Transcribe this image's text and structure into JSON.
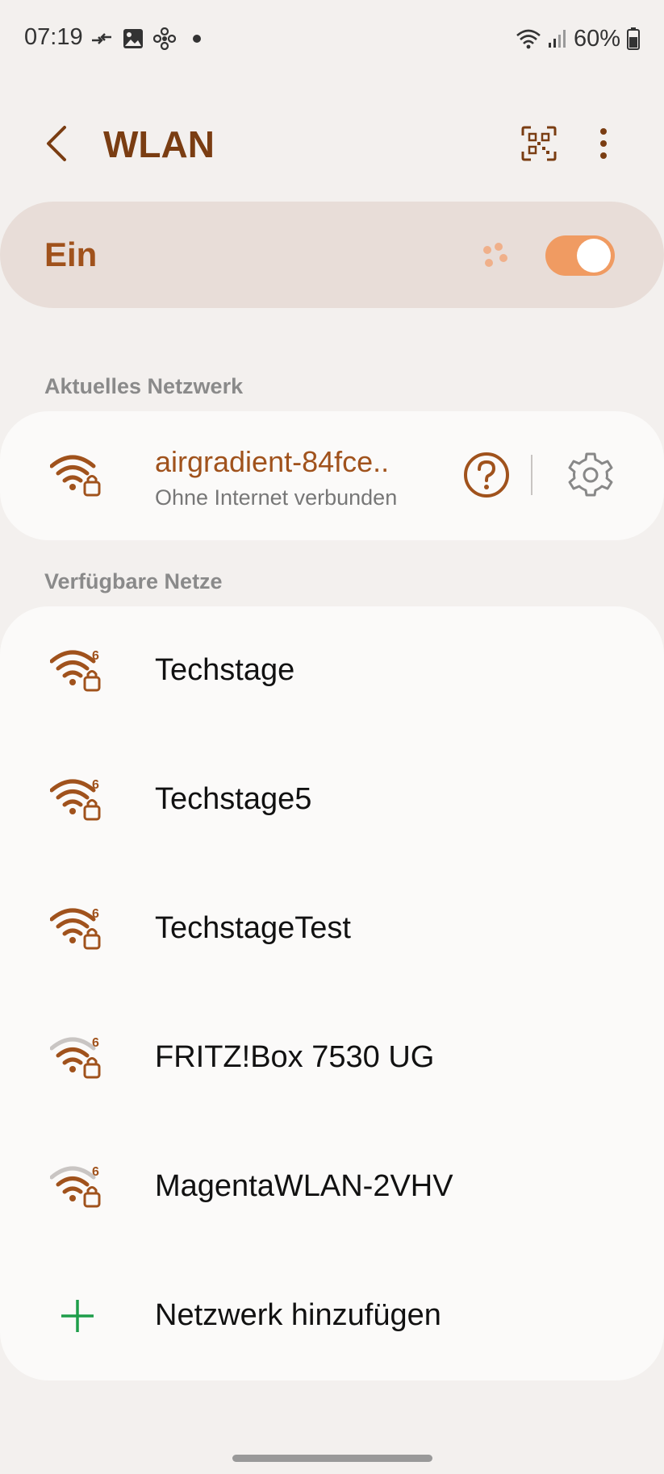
{
  "status_bar": {
    "time": "07:19",
    "battery": "60%"
  },
  "app_bar": {
    "title": "WLAN"
  },
  "toggle": {
    "label": "Ein",
    "state": "on"
  },
  "current_section": {
    "label": "Aktuelles Netzwerk",
    "network": {
      "name": "airgradient-84fce..",
      "status": "Ohne Internet verbunden"
    }
  },
  "available_section": {
    "label": "Verfügbare Netze",
    "networks": [
      {
        "name": "Techstage",
        "signal": "full",
        "band": "6"
      },
      {
        "name": "Techstage5",
        "signal": "full",
        "band": "6"
      },
      {
        "name": "TechstageTest",
        "signal": "full",
        "band": "6"
      },
      {
        "name": "FRITZ!Box 7530 UG",
        "signal": "medium",
        "band": "6"
      },
      {
        "name": "MagentaWLAN-2VHV",
        "signal": "medium",
        "band": "6"
      }
    ],
    "add_network": "Netzwerk hinzufügen"
  },
  "colors": {
    "accent": "#a0521c",
    "title": "#7a3d12",
    "toggle_on": "#f09b62",
    "add_plus": "#1e9e4a"
  }
}
